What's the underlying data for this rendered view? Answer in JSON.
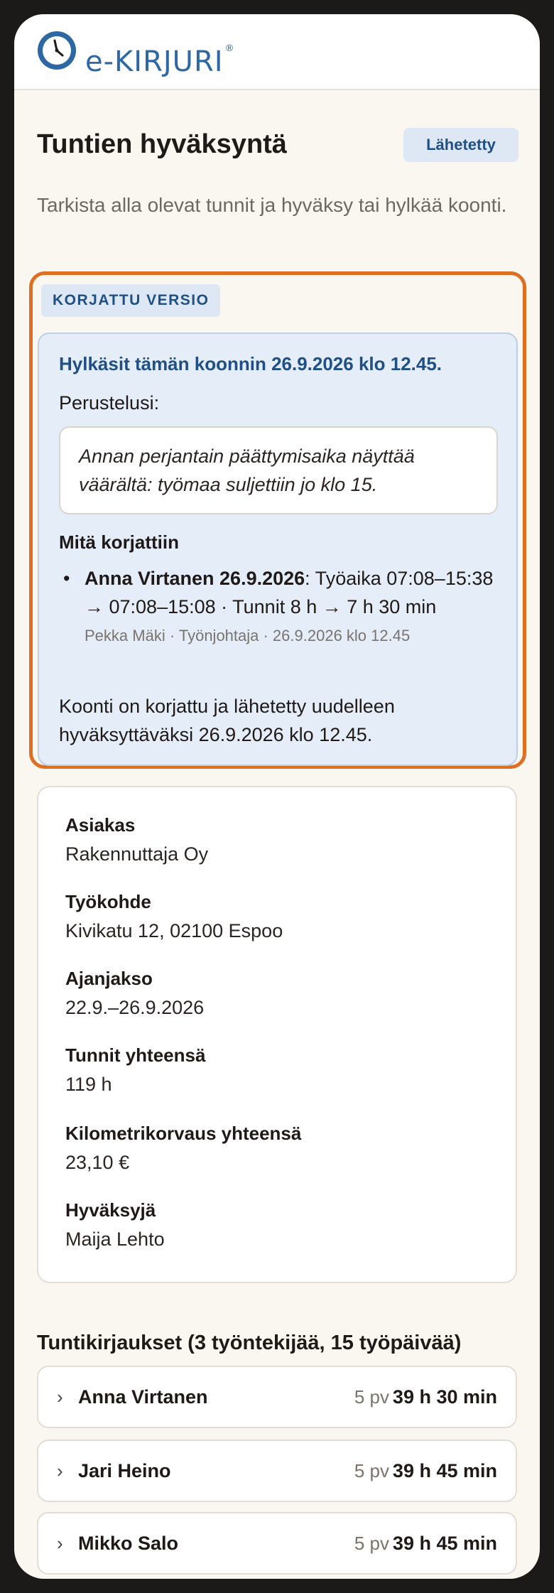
{
  "app": {
    "logo_text": "e-KIRJURI",
    "logo_reg": "®"
  },
  "colors": {
    "brand": "#2d67a4",
    "accent_orange": "#de6f22",
    "badge_bg": "#dde8f4",
    "badge_text": "#1f4f85"
  },
  "page": {
    "title": "Tuntien hyväksyntä",
    "status": "Lähetetty",
    "intro": "Tarkista alla olevat tunnit ja hyväksy tai hylkää koonti."
  },
  "corrected": {
    "tag": "KORJATTU VERSIO",
    "rejection_heading": "Hylkäsit tämän koonnin 26.9.2026 klo 12.45.",
    "reason_label": "Perustelusi:",
    "reason_text": "Annan perjantain päättymisaika näyttää väärältä: työmaa suljettiin jo klo 15.",
    "fixes_heading": "Mitä korjattiin",
    "fixes": [
      {
        "name_date": "Anna Virtanen 26.9.2026",
        "change": ": Työaika 07:08–15:38 → 07:08–15:08 · Tunnit 8 h → 7 h 30 min",
        "meta": "Pekka Mäki · Työnjohtaja · 26.9.2026 klo 12.45"
      }
    ],
    "resent_text": "Koonti on korjattu ja lähetetty uudelleen hyväksyttäväksi 26.9.2026 klo 12.45."
  },
  "info": [
    {
      "label": "Asiakas",
      "value": "Rakennuttaja Oy"
    },
    {
      "label": "Työkohde",
      "value": "Kivikatu 12, 02100 Espoo"
    },
    {
      "label": "Ajanjakso",
      "value": "22.9.–26.9.2026"
    },
    {
      "label": "Tunnit yhteensä",
      "value": "119 h"
    },
    {
      "label": "Kilometrikorvaus yhteensä",
      "value": "23,10 €"
    },
    {
      "label": "Hyväksyjä",
      "value": "Maija Lehto"
    }
  ],
  "entries": {
    "title": "Tuntikirjaukset (3 työntekijää, 15 työpäivää)",
    "workers": [
      {
        "chevron": "›",
        "name": "Anna Virtanen",
        "days": "5 pv",
        "hours": "39 h 30 min"
      },
      {
        "chevron": "›",
        "name": "Jari Heino",
        "days": "5 pv",
        "hours": "39 h 45 min"
      },
      {
        "chevron": "›",
        "name": "Mikko Salo",
        "days": "5 pv",
        "hours": "39 h 45 min"
      }
    ]
  }
}
